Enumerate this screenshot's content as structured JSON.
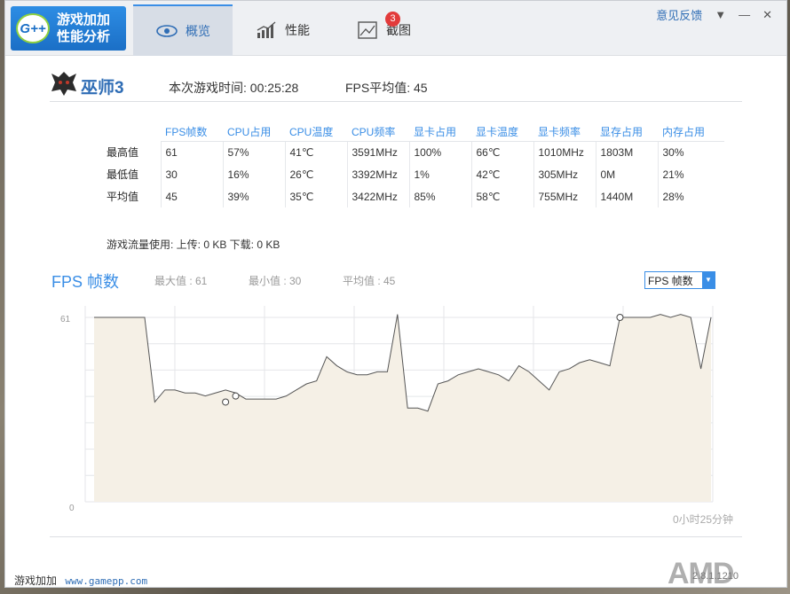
{
  "app": {
    "logo_badge": "G++",
    "logo_line1": "游戏加加",
    "logo_line2": "性能分析"
  },
  "tabs": [
    {
      "label": "概览",
      "icon": "eye-icon",
      "active": true
    },
    {
      "label": "性能",
      "icon": "bar-chart-icon",
      "active": false
    },
    {
      "label": "截图",
      "icon": "image-icon",
      "active": false,
      "badge": "3"
    }
  ],
  "topright": {
    "feedback": "意见反馈",
    "dropdown": "▼",
    "minimize": "—",
    "close": "✕"
  },
  "game": {
    "name": "巫师3",
    "play_time": "本次游戏时间: 00:25:28",
    "fps_avg": "FPS平均值: 45"
  },
  "stats": {
    "headers": [
      "FPS帧数",
      "CPU占用",
      "CPU温度",
      "CPU频率",
      "显卡占用",
      "显卡温度",
      "显卡频率",
      "显存占用",
      "内存占用"
    ],
    "rows": [
      {
        "label": "最高值",
        "values": [
          "61",
          "57%",
          "41℃",
          "3591MHz",
          "100%",
          "66℃",
          "1010MHz",
          "1803M",
          "30%"
        ]
      },
      {
        "label": "最低值",
        "values": [
          "30",
          "16%",
          "26℃",
          "3392MHz",
          "1%",
          "42℃",
          "305MHz",
          "0M",
          "21%"
        ]
      },
      {
        "label": "平均值",
        "values": [
          "45",
          "39%",
          "35℃",
          "3422MHz",
          "85%",
          "58℃",
          "755MHz",
          "1440M",
          "28%"
        ]
      }
    ]
  },
  "traffic": "游戏流量使用: 上传: 0 KB   下载: 0 KB",
  "fps_panel": {
    "title": "FPS 帧数",
    "max": "最大值 : 61",
    "min": "最小值 : 30",
    "avg": "平均值 : 45",
    "select_value": "FPS 帧数",
    "time_label": "0小时25分钟"
  },
  "chart_data": {
    "type": "area",
    "title": "FPS 帧数",
    "ylim": [
      0,
      61
    ],
    "y_ticks": [
      "61",
      "0"
    ],
    "grid": true,
    "values": [
      61,
      61,
      61,
      61,
      61,
      61,
      33,
      37,
      37,
      36,
      36,
      35,
      36,
      37,
      36,
      34,
      34,
      34,
      34,
      35,
      37,
      39,
      40,
      48,
      45,
      43,
      42,
      42,
      43,
      43,
      62,
      31,
      31,
      30,
      39,
      40,
      42,
      43,
      44,
      43,
      42,
      40,
      45,
      43,
      40,
      37,
      43,
      44,
      46,
      47,
      46,
      45,
      61,
      61,
      61,
      61,
      62,
      61,
      62,
      61,
      44,
      61
    ],
    "markers": [
      {
        "index": 13,
        "value": 33
      },
      {
        "index": 14,
        "value": 35
      },
      {
        "index": 52,
        "value": 61
      }
    ],
    "colors": {
      "line": "#555555",
      "fill": "#f5f0e6",
      "marker": "#ffffff"
    }
  },
  "footer": {
    "brand": "游戏加加",
    "url": "www.gamepp.com",
    "version": "2.8.1.1210",
    "watermark": "AMD"
  }
}
